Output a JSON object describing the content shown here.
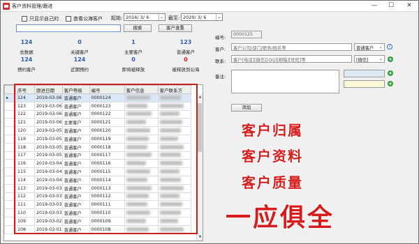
{
  "window": {
    "title": "客户资料管理/跟进",
    "min": "—",
    "max": "☐",
    "close": "✕"
  },
  "filters": {
    "only_mine": "只显示自己的",
    "view_public": "查看公海客户",
    "start_label": "起始:",
    "start_date": "2016/ 3/ 6",
    "end_label": "截至:",
    "end_date": "2020/ 3/ 6",
    "search_value": "",
    "search_button": "搜索",
    "customer_pool_button": "客户查重"
  },
  "stats": [
    {
      "value": "124",
      "label": "总数据",
      "color": "#2c5ea8"
    },
    {
      "value": "0",
      "label": "关键客户",
      "color": "#2c5ea8"
    },
    {
      "value": "1",
      "label": "主要客户",
      "color": "#2c5ea8"
    },
    {
      "value": "123",
      "label": "普通客户",
      "color": "#2c5ea8"
    },
    {
      "value": "124",
      "label": "预约客户",
      "color": "#2c5ea8"
    },
    {
      "value": "124",
      "label": "近期预约",
      "color": "#2c5ea8"
    },
    {
      "value": "0",
      "label": "即将被释放",
      "color": "#2c5ea8"
    },
    {
      "value": "0",
      "label": "被释放到公海",
      "color": "#d61c1c"
    }
  ],
  "table": {
    "columns": [
      "序号",
      "跟进日期",
      "客户等级",
      "编号",
      "客户信息",
      "客户联系方"
    ],
    "rows": [
      [
        "124",
        "2019-03-06",
        "普通客户",
        "0000124"
      ],
      [
        "123",
        "2019-03-06",
        "普通客户",
        "0000123"
      ],
      [
        "122",
        "2019-03-06",
        "普通客户",
        "0000122"
      ],
      [
        "121",
        "2019-03-06",
        "主要客户",
        "0000121"
      ],
      [
        "120",
        "2019-03-05",
        "普通客户",
        "0000120"
      ],
      [
        "119",
        "2019-03-05",
        "普通客户",
        "0000119"
      ],
      [
        "118",
        "2019-03-05",
        "普通客户",
        "0000118"
      ],
      [
        "117",
        "2019-03-05",
        "普通客户",
        "0000117"
      ],
      [
        "116",
        "2019-03-04",
        "普通客户",
        "0000116"
      ],
      [
        "115",
        "2019-03-04",
        "普通客户",
        "0000115"
      ],
      [
        "114",
        "2019-03-04",
        "普通客户",
        "0000114"
      ],
      [
        "113",
        "2019-03-03",
        "普通客户",
        "0000113"
      ],
      [
        "112",
        "2019-03-03",
        "普通客户",
        "0000112"
      ],
      [
        "111",
        "2019-03-03",
        "普通客户",
        "0000111"
      ],
      [
        "110",
        "2019-03-03",
        "普通客户",
        "0000110"
      ],
      [
        "109",
        "2019-03-02",
        "普通客户",
        "0000109"
      ],
      [
        "108",
        "2019-03-01",
        "普通客户",
        "0000108"
      ]
    ],
    "selected_indicator": "▸"
  },
  "form": {
    "id_label": "编号:",
    "id_value": "0000125",
    "customer_label": "客户:",
    "customer_placeholder": "客户公司/部门/职务/姓名等",
    "customer_level": "普通客户",
    "contact_label": "联系:",
    "contact_placeholder": "客户[电话][微信][QQ][邮箱][旺旺]等",
    "contact_type": "[微信]",
    "note_label": "备注:",
    "add_button": "添加",
    "dropdown_arrow": "⌄",
    "help_mark": "?",
    "plus_mark": "+"
  },
  "promo": [
    "客户归属",
    "客户资料",
    "客户质量",
    "一应俱全"
  ]
}
